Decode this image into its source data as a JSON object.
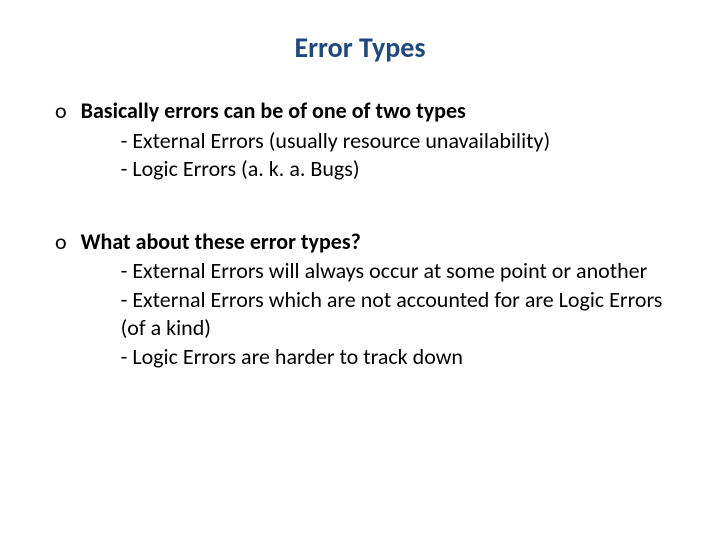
{
  "slide": {
    "title": "Error Types",
    "bullets": [
      {
        "marker": "o",
        "heading": "Basically errors can be of one of two types",
        "subs": [
          "- External Errors (usually resource unavailability)",
          "- Logic Errors (a. k. a. Bugs)"
        ]
      },
      {
        "marker": "o",
        "heading": "What about these error types?",
        "subs": [
          "- External Errors will always occur at some point or another",
          "- External Errors which are not accounted for are Logic Errors (of a kind)",
          "- Logic Errors are harder to track down"
        ]
      }
    ]
  }
}
